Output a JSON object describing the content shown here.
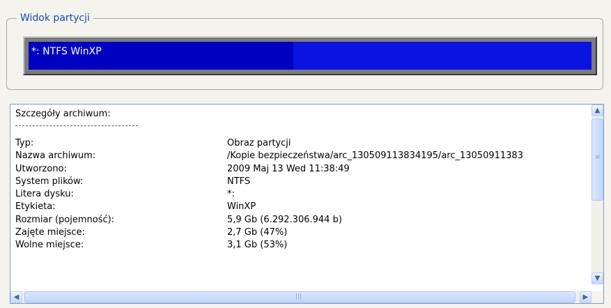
{
  "partition_view": {
    "legend": "Widok partycji",
    "partition_label": "*: NTFS WinXP",
    "used_fraction": 0.47
  },
  "details": {
    "title": "Szczegóły archiwum:",
    "rows": [
      {
        "key": "Typ:",
        "value": "Obraz partycji"
      },
      {
        "key": "Nazwa archiwum:",
        "value": "/Kopie bezpieczeństwa/arc_130509113834195/arc_13050911383"
      },
      {
        "key": "Utworzono:",
        "value": "2009 Maj 13 Wed 11:38:49"
      },
      {
        "key": "System plików:",
        "value": "NTFS"
      },
      {
        "key": "Litera dysku:",
        "value": "*:"
      },
      {
        "key": "Etykieta:",
        "value": "WinXP"
      },
      {
        "key": "Rozmiar (pojemność):",
        "value": "5,9 Gb (6.292.306.944 b)"
      },
      {
        "key": "Zajęte miejsce:",
        "value": "2,7 Gb (47%)"
      },
      {
        "key": "Wolne miejsce:",
        "value": "3,1 Gb (53%)"
      }
    ]
  },
  "colors": {
    "legend": "#1c47b8",
    "partition_fill": "#0a13e2",
    "partition_used": "#0000c0"
  },
  "icons": {
    "scroll_up": "chevron-up-icon",
    "scroll_down": "chevron-down-icon",
    "scroll_left": "chevron-left-icon",
    "scroll_right": "chevron-right-icon"
  }
}
